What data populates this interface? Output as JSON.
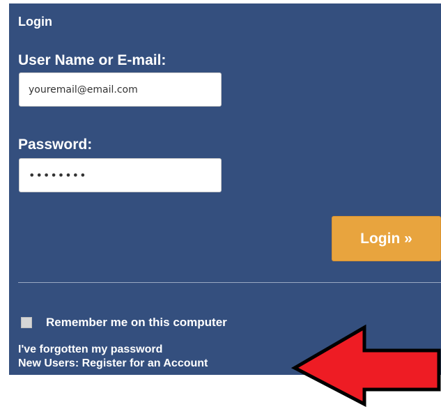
{
  "login": {
    "title": "Login",
    "username_label": "User Name or E-mail:",
    "username_value": "youremail@email.com",
    "password_label": "Password:",
    "password_value": "••••••••",
    "submit_label": "Login »",
    "remember_label": "Remember me on this computer",
    "remember_checked": false,
    "forgot_link": "I've forgotten my password",
    "register_link": "New Users: Register for an Account"
  },
  "colors": {
    "panel_background": "#344f7e",
    "button_background": "#e8a43e",
    "arrow_fill": "#ee1c24"
  },
  "icons": {
    "annotation": "red-arrow-left-icon"
  }
}
